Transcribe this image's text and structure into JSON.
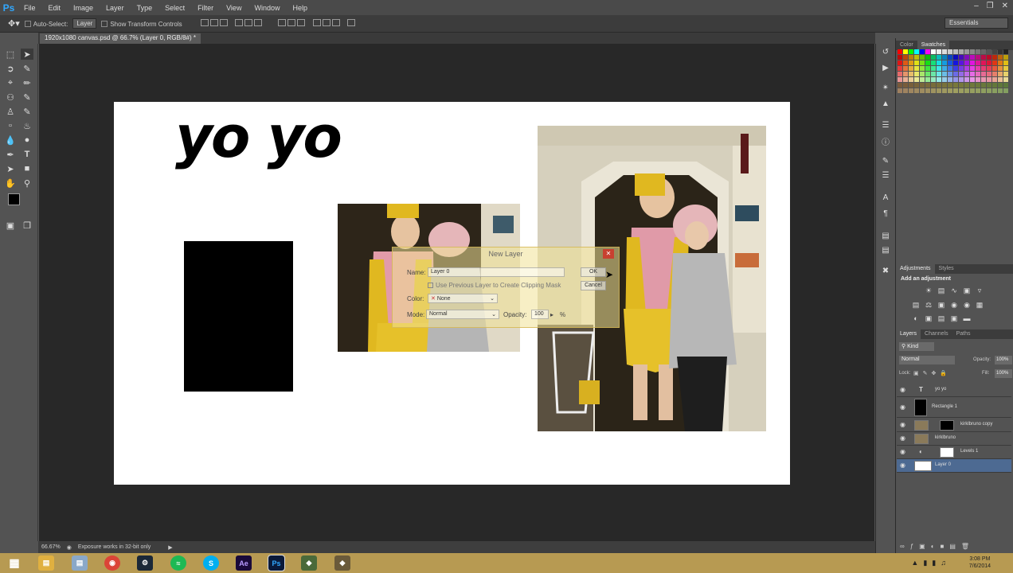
{
  "app": {
    "logo": "Ps"
  },
  "menu": [
    "File",
    "Edit",
    "Image",
    "Layer",
    "Type",
    "Select",
    "Filter",
    "View",
    "Window",
    "Help"
  ],
  "options_bar": {
    "auto_select_label": "Auto-Select:",
    "auto_select_value": "Layer",
    "show_transform_label": "Show Transform Controls",
    "workspace": "Essentials"
  },
  "document_tab": "1920x1080 canvas.psd @ 66.7% (Layer 0, RGB/8#) *",
  "canvas": {
    "text_layer": "yo yo"
  },
  "dialog": {
    "title": "New Layer",
    "name_label": "Name:",
    "name_value": "Layer 0",
    "clipping_label": "Use Previous Layer to Create Clipping Mask",
    "color_label": "Color:",
    "color_value": "None",
    "mode_label": "Mode:",
    "mode_value": "Normal",
    "opacity_label": "Opacity:",
    "opacity_value": "100",
    "opacity_unit": "%",
    "ok": "OK",
    "cancel": "Cancel"
  },
  "status_bar": {
    "zoom": "66.67%",
    "message": "Exposure works in 32-bit only"
  },
  "panels": {
    "color_tabs": [
      "Color",
      "Swatches"
    ],
    "adjust_tabs": [
      "Adjustments",
      "Styles"
    ],
    "adjust_heading": "Add an adjustment",
    "layers_tabs": [
      "Layers",
      "Channels",
      "Paths"
    ],
    "kind_filter": "Kind",
    "blend_mode": "Normal",
    "opacity_label": "Opacity:",
    "opacity_value": "100%",
    "lock_label": "Lock:",
    "fill_label": "Fill:",
    "fill_value": "100%"
  },
  "layers": [
    {
      "name": "yo yo"
    },
    {
      "name": "Rectangle 1"
    },
    {
      "name": "kirklbruno copy"
    },
    {
      "name": "kirklbruno"
    },
    {
      "name": "Levels 1"
    },
    {
      "name": "Layer 0"
    }
  ],
  "taskbar": {
    "time": "3:08 PM",
    "date": "7/6/2014"
  },
  "colors": {
    "ps_blue": "#31a8ff",
    "selection": "#4d6a92",
    "taskbar": "#b79a52"
  }
}
